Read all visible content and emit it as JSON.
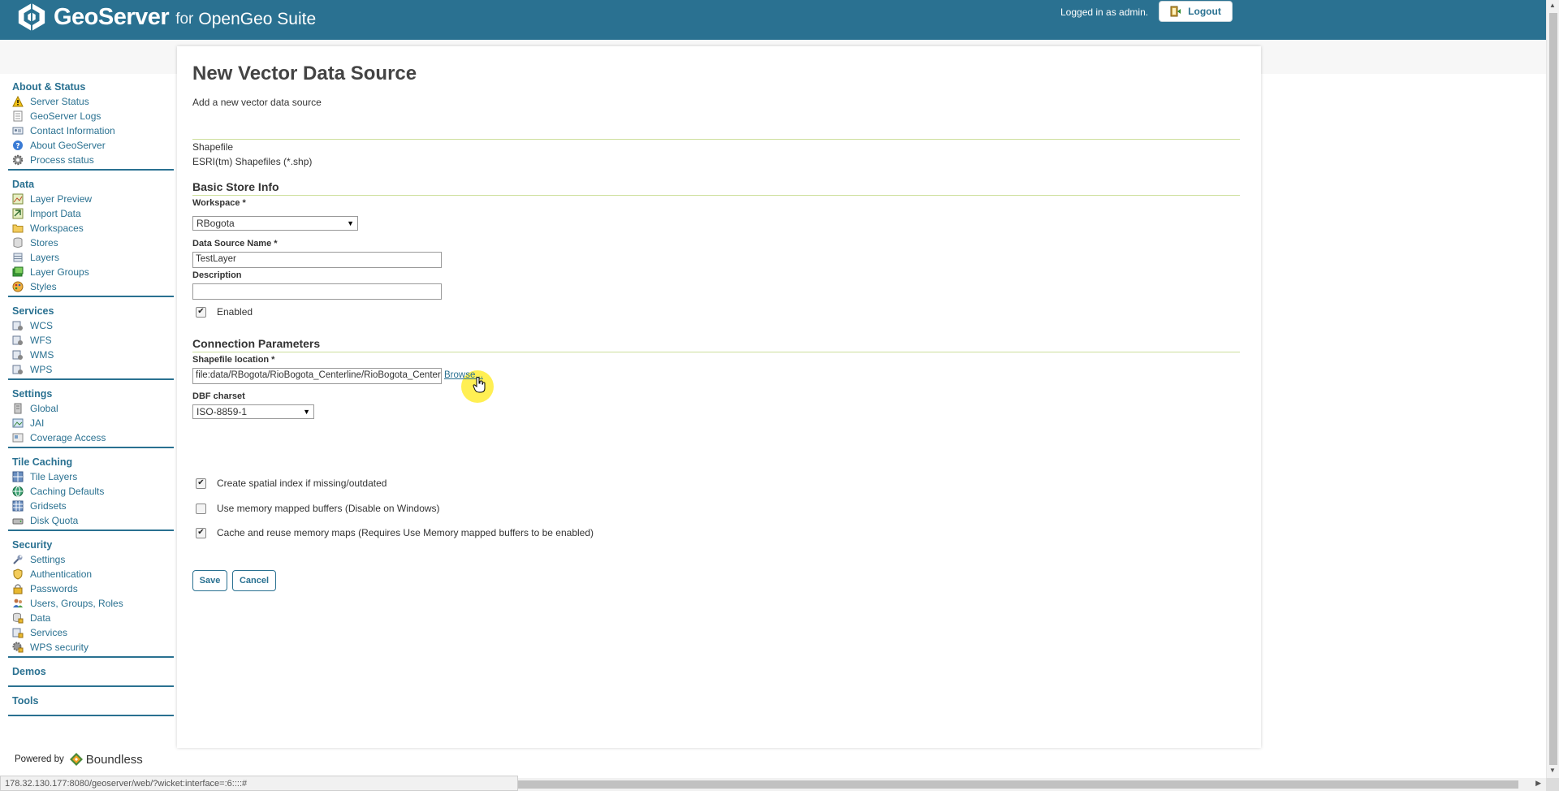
{
  "header": {
    "app_name": "GeoServer",
    "for_text": "for",
    "suite_name": "OpenGeo Suite",
    "logged_in_text": "Logged in as admin.",
    "logout_label": "Logout",
    "bg_color": "#2a7191"
  },
  "sidebar": {
    "sections": [
      {
        "title": "About & Status",
        "items": [
          "Server Status",
          "GeoServer Logs",
          "Contact Information",
          "About GeoServer",
          "Process status"
        ]
      },
      {
        "title": "Data",
        "items": [
          "Layer Preview",
          "Import Data",
          "Workspaces",
          "Stores",
          "Layers",
          "Layer Groups",
          "Styles"
        ]
      },
      {
        "title": "Services",
        "items": [
          "WCS",
          "WFS",
          "WMS",
          "WPS"
        ]
      },
      {
        "title": "Settings",
        "items": [
          "Global",
          "JAI",
          "Coverage Access"
        ]
      },
      {
        "title": "Tile Caching",
        "items": [
          "Tile Layers",
          "Caching Defaults",
          "Gridsets",
          "Disk Quota"
        ]
      },
      {
        "title": "Security",
        "items": [
          "Settings",
          "Authentication",
          "Passwords",
          "Users, Groups, Roles",
          "Data",
          "Services",
          "WPS security"
        ]
      },
      {
        "title": "Demos",
        "items": []
      },
      {
        "title": "Tools",
        "items": []
      }
    ],
    "powered_by": "Powered by",
    "powered_brand": "Boundless"
  },
  "page": {
    "title": "New Vector Data Source",
    "description": "Add a new vector data source",
    "store_type": "Shapefile",
    "store_type_desc": "ESRI(tm) Shapefiles (*.shp)",
    "basic_section": "Basic Store Info",
    "workspace_label": "Workspace *",
    "workspace_value": "RBogota",
    "name_label": "Data Source Name *",
    "name_value": "TestLayer",
    "description_label": "Description",
    "description_value": "",
    "enabled_label": "Enabled",
    "connection_section": "Connection Parameters",
    "shapefile_label": "Shapefile location *",
    "shapefile_value": "file:data/RBogota/RioBogota_Centerline/RioBogota_Centerline.shp",
    "browse_label": "Browse...",
    "charset_label": "DBF charset",
    "charset_value": "ISO-8859-1",
    "spatial_index_label": "Create spatial index if missing/outdated",
    "memory_mapped_label": "Use memory mapped buffers (Disable on Windows)",
    "cache_maps_label": "Cache and reuse memory maps (Requires Use Memory mapped buffers to be enabled)",
    "save_label": "Save",
    "cancel_label": "Cancel"
  },
  "checkboxes": {
    "enabled": true,
    "spatial_index": true,
    "memory_mapped": false,
    "cache_maps": true
  },
  "status_bar": {
    "url": "178.32.130.177:8080/geoserver/web/?wicket:interface=:6::::#"
  }
}
